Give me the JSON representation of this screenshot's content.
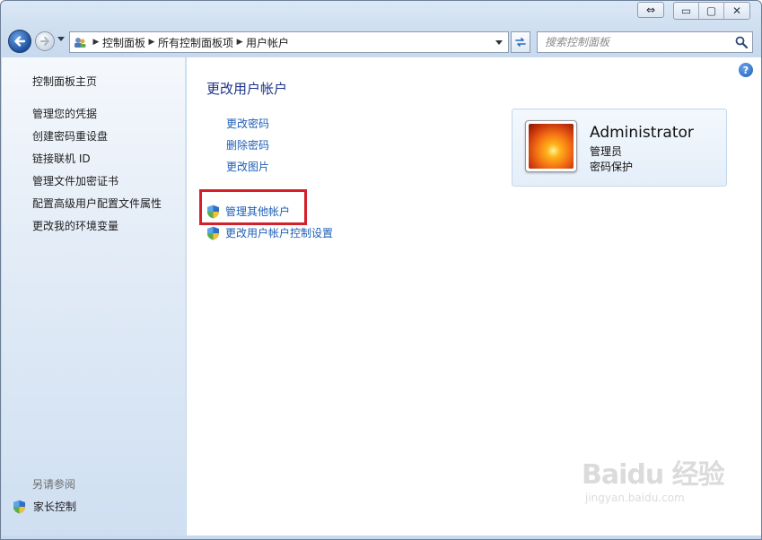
{
  "window": {
    "caption": {
      "snap": "⇔",
      "minimize": "▭",
      "maximize": "▢",
      "close": "✕"
    }
  },
  "nav": {
    "breadcrumbs": [
      "控制面板",
      "所有控制面板项",
      "用户帐户"
    ],
    "search_placeholder": "搜索控制面板"
  },
  "sidebar": {
    "home": "控制面板主页",
    "links": [
      "管理您的凭据",
      "创建密码重设盘",
      "链接联机 ID",
      "管理文件加密证书",
      "配置高级用户配置文件属性",
      "更改我的环境变量"
    ],
    "see_also": "另请参阅",
    "parental": "家长控制"
  },
  "main": {
    "title": "更改用户帐户",
    "tasks": [
      "更改密码",
      "删除密码",
      "更改图片"
    ],
    "admin_tasks": [
      "管理其他帐户",
      "更改用户帐户控制设置"
    ]
  },
  "user": {
    "name": "Administrator",
    "role": "管理员",
    "status": "密码保护"
  },
  "watermark": {
    "logo": "Baidu 经验",
    "url": "jingyan.baidu.com"
  },
  "colors": {
    "link": "#1e5eb6",
    "title": "#1e3287",
    "highlight": "#d4202a"
  }
}
